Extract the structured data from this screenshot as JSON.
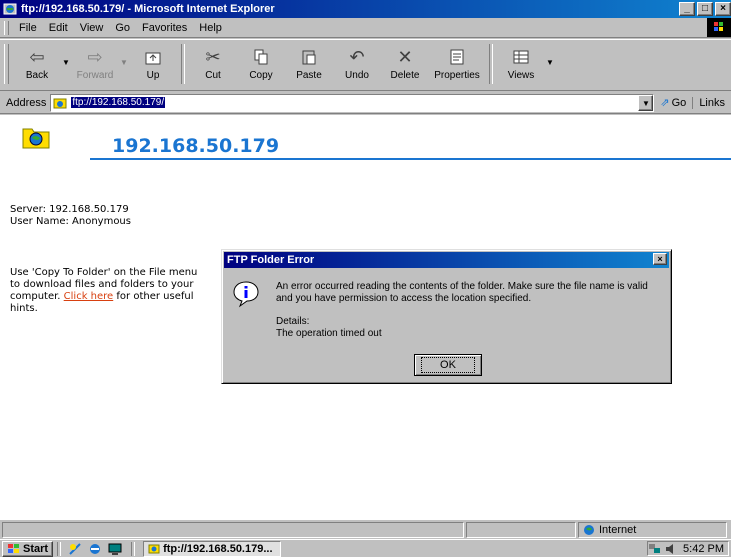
{
  "window": {
    "title": "ftp://192.168.50.179/ - Microsoft Internet Explorer"
  },
  "menu": [
    "File",
    "Edit",
    "View",
    "Go",
    "Favorites",
    "Help"
  ],
  "toolbar": {
    "back": "Back",
    "forward": "Forward",
    "up": "Up",
    "cut": "Cut",
    "copy": "Copy",
    "paste": "Paste",
    "undo": "Undo",
    "delete": "Delete",
    "properties": "Properties",
    "views": "Views"
  },
  "address": {
    "label": "Address",
    "url": "ftp://192.168.50.179/",
    "go": "Go",
    "links": "Links"
  },
  "page": {
    "host": "192.168.50.179",
    "server_line": "Server: 192.168.50.179",
    "user_line": "User Name: Anonymous",
    "hint_before": "Use 'Copy To Folder' on the File menu to download files and folders to your computer. ",
    "hint_link": "Click here",
    "hint_after": " for other useful hints."
  },
  "dialog": {
    "title": "FTP Folder Error",
    "message": "An error occurred reading the contents of the folder.  Make sure the file name is valid and you have permission to access the location specified.",
    "details_label": "Details:",
    "details_value": "The operation timed out",
    "ok": "OK"
  },
  "status": {
    "zone": "Internet"
  },
  "taskbar": {
    "start": "Start",
    "task": "ftp://192.168.50.179...",
    "clock": "5:42 PM"
  }
}
